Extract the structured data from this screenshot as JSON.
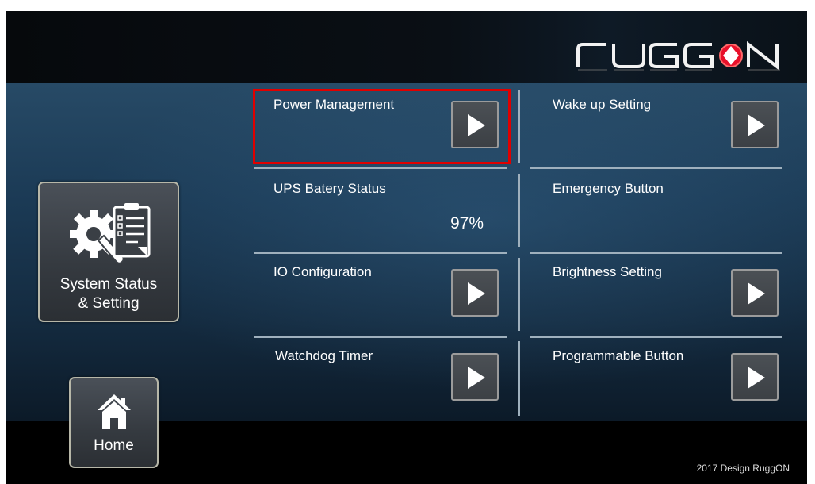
{
  "brand": {
    "logo_text": "RUGGON"
  },
  "sidebar": {
    "system_status": {
      "label_line1": "System Status",
      "label_line2": "& Setting",
      "icon": "gear-checklist-icon"
    },
    "home": {
      "label": "Home",
      "icon": "house-icon"
    }
  },
  "grid": {
    "power_management": {
      "label": "Power Management",
      "highlighted": true
    },
    "wake_up_setting": {
      "label": "Wake up Setting"
    },
    "ups_battery_status": {
      "label": "UPS Batery Status",
      "value": "97%"
    },
    "emergency_button": {
      "label": "Emergency Button"
    },
    "io_configuration": {
      "label": "IO Configuration"
    },
    "brightness_setting": {
      "label": "Brightness Setting"
    },
    "watchdog_timer": {
      "label": "Watchdog Timer"
    },
    "programmable_button": {
      "label": "Programmable Button"
    }
  },
  "footer": {
    "copyright": "2017 Design RuggON"
  },
  "colors": {
    "highlight": "#e00000",
    "logo_red": "#e8102a",
    "panel_blue": "#1b3a55"
  }
}
